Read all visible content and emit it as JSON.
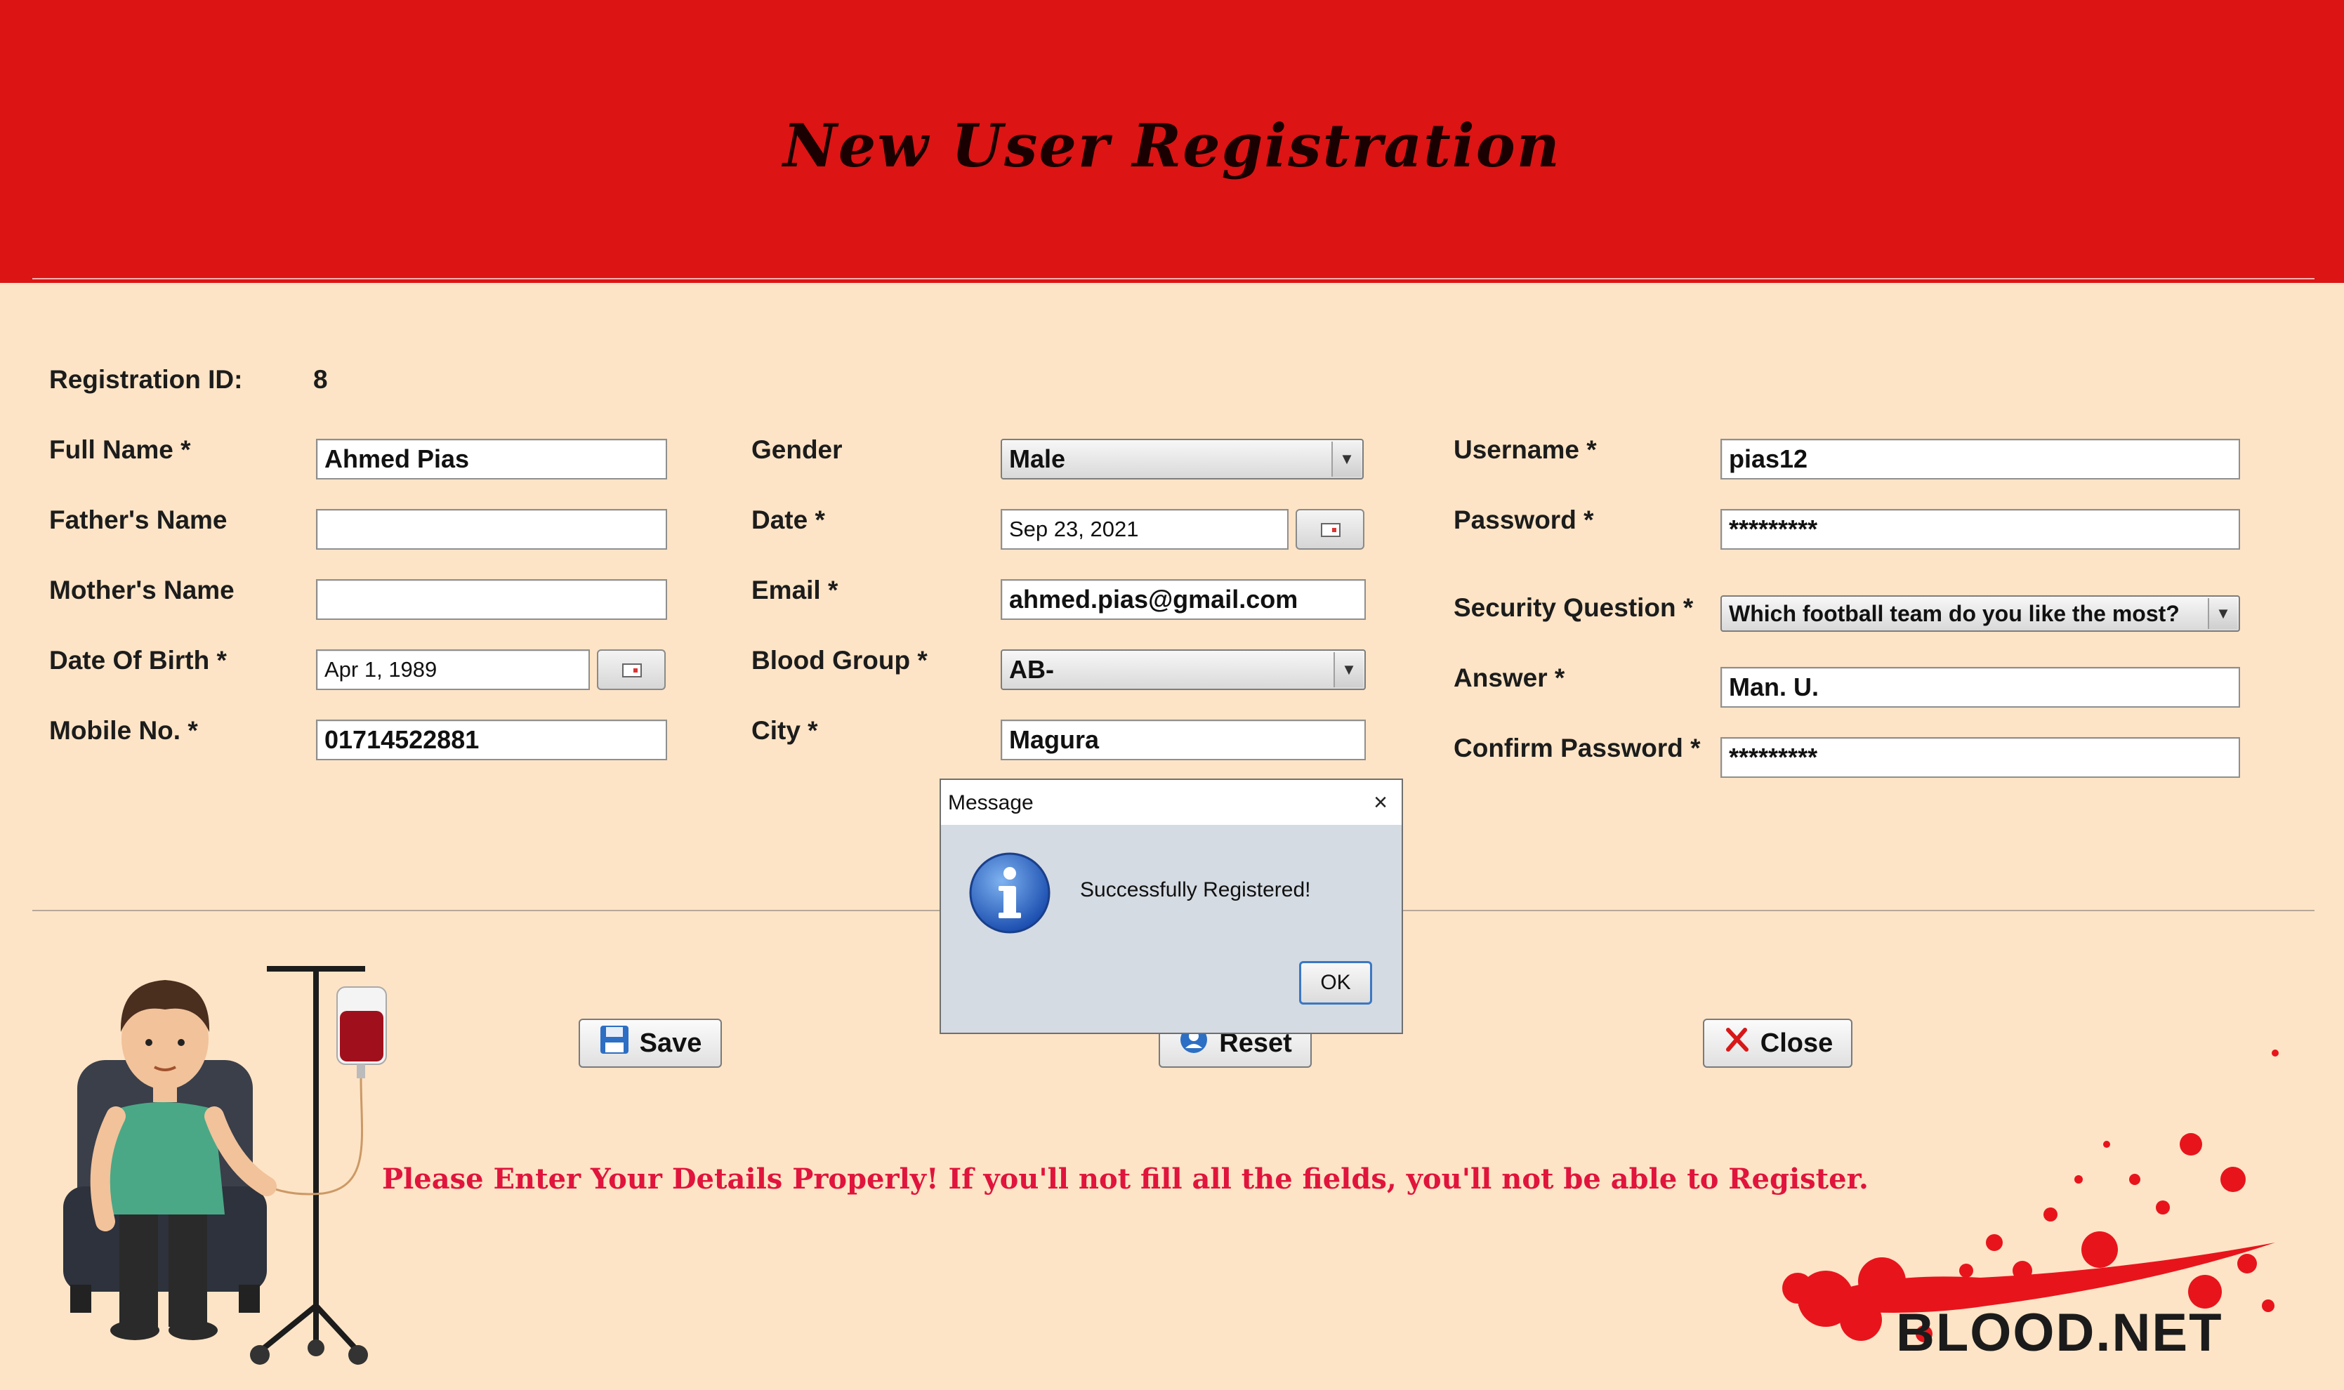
{
  "header": {
    "title": "New User Registration"
  },
  "form": {
    "registration_id_label": "Registration ID:",
    "registration_id_value": "8",
    "full_name_label": "Full Name *",
    "full_name_value": "Ahmed Pias",
    "fathers_name_label": "Father's Name",
    "fathers_name_value": "",
    "mothers_name_label": "Mother's Name",
    "mothers_name_value": "",
    "dob_label": "Date Of Birth *",
    "dob_value": "Apr 1, 1989",
    "mobile_label": "Mobile No. *",
    "mobile_value": "01714522881",
    "gender_label": "Gender",
    "gender_value": "Male",
    "date_label": "Date *",
    "date_value": "Sep 23, 2021",
    "email_label": "Email *",
    "email_value": "ahmed.pias@gmail.com",
    "blood_group_label": "Blood Group *",
    "blood_group_value": "AB-",
    "city_label": "City *",
    "city_value": "Magura",
    "username_label": "Username *",
    "username_value": "pias12",
    "password_label": "Password *",
    "password_value": "*********",
    "security_question_label": "Security Question *",
    "security_question_value": "Which football team do you like the most?",
    "answer_label": "Answer *",
    "answer_value": "Man. U.",
    "confirm_password_label": "Confirm Password *",
    "confirm_password_value": "*********"
  },
  "buttons": {
    "save": "Save",
    "reset": "Reset",
    "close": "Close"
  },
  "warning_text": "Please Enter Your Details Properly! If you'll not fill all the fields, you'll not be able to Register.",
  "dialog": {
    "title": "Message",
    "close_glyph": "×",
    "message": "Successfully Registered!",
    "ok_label": "OK",
    "icon": "info-icon"
  },
  "brand": "BLOOD.NET",
  "colors": {
    "header_bg": "#dc1414",
    "body_bg": "#fde4c6",
    "warning": "#e0143c",
    "blood": "#e8141c"
  }
}
